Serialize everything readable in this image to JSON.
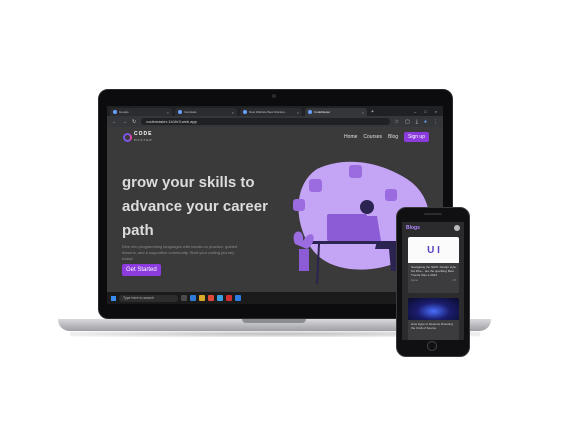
{
  "browser": {
    "tabs": [
      {
        "label": "Google",
        "active": false
      },
      {
        "label": "Interstate",
        "active": false
      },
      {
        "label": "New Website Best Mockup...",
        "active": false
      },
      {
        "label": "CodeMaster",
        "active": true
      }
    ],
    "new_tab": "+",
    "url": "codemaster-1b1fe3.web.app"
  },
  "site": {
    "logo": {
      "name": "CODE",
      "sub": "MASTER"
    },
    "nav": [
      "Home",
      "Courses",
      "Blog"
    ],
    "signup_label": "Sign up",
    "hero": {
      "title": "grow your skills to advance your career path",
      "description": "Dive into programming languages with hands-on practice, guided lessons, and a supportive community. Start your coding journey today!",
      "cta_label": "Get Started"
    }
  },
  "taskbar": {
    "search_placeholder": "Type here to search",
    "weather": "27°C Sunny"
  },
  "phone": {
    "header_title": "Blogs",
    "cards": [
      {
        "image_text": "U I",
        "title": "Navigating the NEW: Design style but lithe... are the sparkling Best Trends than a 2024",
        "author": "Home",
        "meta": "4.5"
      },
      {
        "image_text": "",
        "title": "How Hype to Deserve Directing the Craft of Source",
        "author": "",
        "meta": ""
      }
    ]
  },
  "colors": {
    "accent": "#8b3bde",
    "site_bg": "#3a3a3a",
    "illustration": "#b48cf2"
  }
}
